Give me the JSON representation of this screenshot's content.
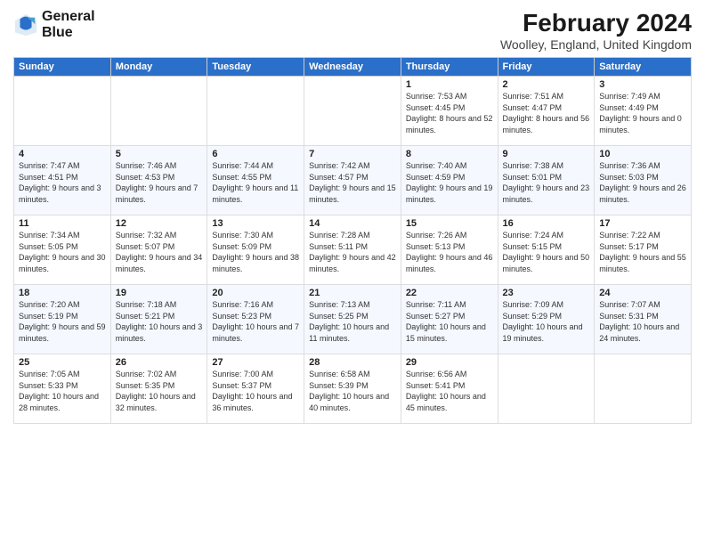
{
  "header": {
    "logo_line1": "General",
    "logo_line2": "Blue",
    "title": "February 2024",
    "subtitle": "Woolley, England, United Kingdom"
  },
  "weekdays": [
    "Sunday",
    "Monday",
    "Tuesday",
    "Wednesday",
    "Thursday",
    "Friday",
    "Saturday"
  ],
  "weeks": [
    [
      {
        "day": "",
        "sunrise": "",
        "sunset": "",
        "daylight": ""
      },
      {
        "day": "",
        "sunrise": "",
        "sunset": "",
        "daylight": ""
      },
      {
        "day": "",
        "sunrise": "",
        "sunset": "",
        "daylight": ""
      },
      {
        "day": "",
        "sunrise": "",
        "sunset": "",
        "daylight": ""
      },
      {
        "day": "1",
        "sunrise": "Sunrise: 7:53 AM",
        "sunset": "Sunset: 4:45 PM",
        "daylight": "Daylight: 8 hours and 52 minutes."
      },
      {
        "day": "2",
        "sunrise": "Sunrise: 7:51 AM",
        "sunset": "Sunset: 4:47 PM",
        "daylight": "Daylight: 8 hours and 56 minutes."
      },
      {
        "day": "3",
        "sunrise": "Sunrise: 7:49 AM",
        "sunset": "Sunset: 4:49 PM",
        "daylight": "Daylight: 9 hours and 0 minutes."
      }
    ],
    [
      {
        "day": "4",
        "sunrise": "Sunrise: 7:47 AM",
        "sunset": "Sunset: 4:51 PM",
        "daylight": "Daylight: 9 hours and 3 minutes."
      },
      {
        "day": "5",
        "sunrise": "Sunrise: 7:46 AM",
        "sunset": "Sunset: 4:53 PM",
        "daylight": "Daylight: 9 hours and 7 minutes."
      },
      {
        "day": "6",
        "sunrise": "Sunrise: 7:44 AM",
        "sunset": "Sunset: 4:55 PM",
        "daylight": "Daylight: 9 hours and 11 minutes."
      },
      {
        "day": "7",
        "sunrise": "Sunrise: 7:42 AM",
        "sunset": "Sunset: 4:57 PM",
        "daylight": "Daylight: 9 hours and 15 minutes."
      },
      {
        "day": "8",
        "sunrise": "Sunrise: 7:40 AM",
        "sunset": "Sunset: 4:59 PM",
        "daylight": "Daylight: 9 hours and 19 minutes."
      },
      {
        "day": "9",
        "sunrise": "Sunrise: 7:38 AM",
        "sunset": "Sunset: 5:01 PM",
        "daylight": "Daylight: 9 hours and 23 minutes."
      },
      {
        "day": "10",
        "sunrise": "Sunrise: 7:36 AM",
        "sunset": "Sunset: 5:03 PM",
        "daylight": "Daylight: 9 hours and 26 minutes."
      }
    ],
    [
      {
        "day": "11",
        "sunrise": "Sunrise: 7:34 AM",
        "sunset": "Sunset: 5:05 PM",
        "daylight": "Daylight: 9 hours and 30 minutes."
      },
      {
        "day": "12",
        "sunrise": "Sunrise: 7:32 AM",
        "sunset": "Sunset: 5:07 PM",
        "daylight": "Daylight: 9 hours and 34 minutes."
      },
      {
        "day": "13",
        "sunrise": "Sunrise: 7:30 AM",
        "sunset": "Sunset: 5:09 PM",
        "daylight": "Daylight: 9 hours and 38 minutes."
      },
      {
        "day": "14",
        "sunrise": "Sunrise: 7:28 AM",
        "sunset": "Sunset: 5:11 PM",
        "daylight": "Daylight: 9 hours and 42 minutes."
      },
      {
        "day": "15",
        "sunrise": "Sunrise: 7:26 AM",
        "sunset": "Sunset: 5:13 PM",
        "daylight": "Daylight: 9 hours and 46 minutes."
      },
      {
        "day": "16",
        "sunrise": "Sunrise: 7:24 AM",
        "sunset": "Sunset: 5:15 PM",
        "daylight": "Daylight: 9 hours and 50 minutes."
      },
      {
        "day": "17",
        "sunrise": "Sunrise: 7:22 AM",
        "sunset": "Sunset: 5:17 PM",
        "daylight": "Daylight: 9 hours and 55 minutes."
      }
    ],
    [
      {
        "day": "18",
        "sunrise": "Sunrise: 7:20 AM",
        "sunset": "Sunset: 5:19 PM",
        "daylight": "Daylight: 9 hours and 59 minutes."
      },
      {
        "day": "19",
        "sunrise": "Sunrise: 7:18 AM",
        "sunset": "Sunset: 5:21 PM",
        "daylight": "Daylight: 10 hours and 3 minutes."
      },
      {
        "day": "20",
        "sunrise": "Sunrise: 7:16 AM",
        "sunset": "Sunset: 5:23 PM",
        "daylight": "Daylight: 10 hours and 7 minutes."
      },
      {
        "day": "21",
        "sunrise": "Sunrise: 7:13 AM",
        "sunset": "Sunset: 5:25 PM",
        "daylight": "Daylight: 10 hours and 11 minutes."
      },
      {
        "day": "22",
        "sunrise": "Sunrise: 7:11 AM",
        "sunset": "Sunset: 5:27 PM",
        "daylight": "Daylight: 10 hours and 15 minutes."
      },
      {
        "day": "23",
        "sunrise": "Sunrise: 7:09 AM",
        "sunset": "Sunset: 5:29 PM",
        "daylight": "Daylight: 10 hours and 19 minutes."
      },
      {
        "day": "24",
        "sunrise": "Sunrise: 7:07 AM",
        "sunset": "Sunset: 5:31 PM",
        "daylight": "Daylight: 10 hours and 24 minutes."
      }
    ],
    [
      {
        "day": "25",
        "sunrise": "Sunrise: 7:05 AM",
        "sunset": "Sunset: 5:33 PM",
        "daylight": "Daylight: 10 hours and 28 minutes."
      },
      {
        "day": "26",
        "sunrise": "Sunrise: 7:02 AM",
        "sunset": "Sunset: 5:35 PM",
        "daylight": "Daylight: 10 hours and 32 minutes."
      },
      {
        "day": "27",
        "sunrise": "Sunrise: 7:00 AM",
        "sunset": "Sunset: 5:37 PM",
        "daylight": "Daylight: 10 hours and 36 minutes."
      },
      {
        "day": "28",
        "sunrise": "Sunrise: 6:58 AM",
        "sunset": "Sunset: 5:39 PM",
        "daylight": "Daylight: 10 hours and 40 minutes."
      },
      {
        "day": "29",
        "sunrise": "Sunrise: 6:56 AM",
        "sunset": "Sunset: 5:41 PM",
        "daylight": "Daylight: 10 hours and 45 minutes."
      },
      {
        "day": "",
        "sunrise": "",
        "sunset": "",
        "daylight": ""
      },
      {
        "day": "",
        "sunrise": "",
        "sunset": "",
        "daylight": ""
      }
    ]
  ]
}
